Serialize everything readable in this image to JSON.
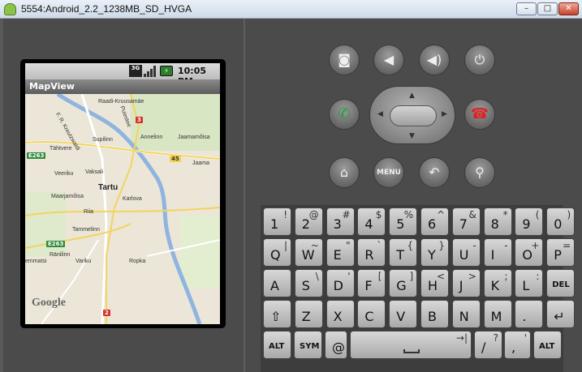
{
  "window": {
    "title": "5554:Android_2.2_1238MB_SD_HVGA",
    "min": "–",
    "max": "□",
    "close": "✕"
  },
  "statusbar": {
    "network": "3G",
    "battery": "⚡",
    "time": "10:05 PM"
  },
  "app": {
    "title": "MapView"
  },
  "map": {
    "labels": [
      {
        "text": "Raadi-Kruusamäe",
        "kind": "label"
      },
      {
        "text": "Supilinn",
        "kind": "label"
      },
      {
        "text": "Annelinn",
        "kind": "label"
      },
      {
        "text": "Jaamamõisa",
        "kind": "label"
      },
      {
        "text": "Tähtvere",
        "kind": "label"
      },
      {
        "text": "Veeriku",
        "kind": "label"
      },
      {
        "text": "Vaksali",
        "kind": "label"
      },
      {
        "text": "Tartu",
        "kind": "city"
      },
      {
        "text": "Karlova",
        "kind": "label"
      },
      {
        "text": "Maarjamõisa",
        "kind": "label"
      },
      {
        "text": "Tammelinn",
        "kind": "label"
      },
      {
        "text": "Ränilinn",
        "kind": "label"
      },
      {
        "text": "Variku",
        "kind": "label"
      },
      {
        "text": "Ropka",
        "kind": "label"
      },
      {
        "text": "emmatsi",
        "kind": "label"
      },
      {
        "text": "Riia",
        "kind": "label"
      },
      {
        "text": "Jaama",
        "kind": "label"
      },
      {
        "text": "F. R. Kreutzwaldi",
        "kind": "label"
      },
      {
        "text": "Puiestee",
        "kind": "label"
      }
    ],
    "shields": [
      {
        "text": "3",
        "color": "red"
      },
      {
        "text": "E263",
        "color": "green"
      },
      {
        "text": "45",
        "color": "yellow"
      },
      {
        "text": "E263",
        "color": "green"
      },
      {
        "text": "2",
        "color": "red"
      }
    ],
    "attribution": "Google"
  },
  "controls": {
    "camera": "camera-icon",
    "volume_down": "volume-down-icon",
    "volume_up": "volume-up-icon",
    "power": "power-icon",
    "call": "call-icon",
    "end_call": "end-call-icon",
    "home": "home-icon",
    "menu": "MENU",
    "back": "back-icon",
    "search": "search-icon"
  },
  "keyboard": {
    "row1": [
      {
        "m": "1",
        "a": "!"
      },
      {
        "m": "2",
        "a": "@"
      },
      {
        "m": "3",
        "a": "#"
      },
      {
        "m": "4",
        "a": "$"
      },
      {
        "m": "5",
        "a": "%"
      },
      {
        "m": "6",
        "a": "^"
      },
      {
        "m": "7",
        "a": "&"
      },
      {
        "m": "8",
        "a": "*"
      },
      {
        "m": "9",
        "a": "("
      },
      {
        "m": "0",
        "a": ")"
      }
    ],
    "row2": [
      {
        "m": "Q",
        "a": "|"
      },
      {
        "m": "W",
        "a": "~"
      },
      {
        "m": "E",
        "a": "\""
      },
      {
        "m": "R",
        "a": "`"
      },
      {
        "m": "T",
        "a": "{"
      },
      {
        "m": "Y",
        "a": "}"
      },
      {
        "m": "U",
        "a": "-"
      },
      {
        "m": "I",
        "a": "-"
      },
      {
        "m": "O",
        "a": "+"
      },
      {
        "m": "P",
        "a": "="
      }
    ],
    "row3": [
      {
        "m": "A",
        "a": ""
      },
      {
        "m": "S",
        "a": "\\"
      },
      {
        "m": "D",
        "a": "'"
      },
      {
        "m": "F",
        "a": "["
      },
      {
        "m": "G",
        "a": "]"
      },
      {
        "m": "H",
        "a": "<"
      },
      {
        "m": "J",
        "a": ">"
      },
      {
        "m": "K",
        "a": ";"
      },
      {
        "m": "L",
        "a": ":"
      },
      {
        "m": "DEL",
        "a": ""
      }
    ],
    "row4": [
      {
        "m": "⇧",
        "a": ""
      },
      {
        "m": "Z",
        "a": ""
      },
      {
        "m": "X",
        "a": ""
      },
      {
        "m": "C",
        "a": ""
      },
      {
        "m": "V",
        "a": ""
      },
      {
        "m": "B",
        "a": ""
      },
      {
        "m": "N",
        "a": ""
      },
      {
        "m": "M",
        "a": ""
      },
      {
        "m": ".",
        "a": ""
      },
      {
        "m": "↵",
        "a": ""
      }
    ],
    "row5": [
      {
        "m": "ALT",
        "a": ""
      },
      {
        "m": "SYM",
        "a": ""
      },
      {
        "m": "@",
        "a": ""
      },
      {
        "m": "",
        "a": "→|"
      },
      {
        "m": "/",
        "a": "?"
      },
      {
        "m": "ALT",
        "a": ""
      }
    ],
    "row5_extra": {
      "comma_main": ",",
      "comma_alt": "'"
    }
  }
}
